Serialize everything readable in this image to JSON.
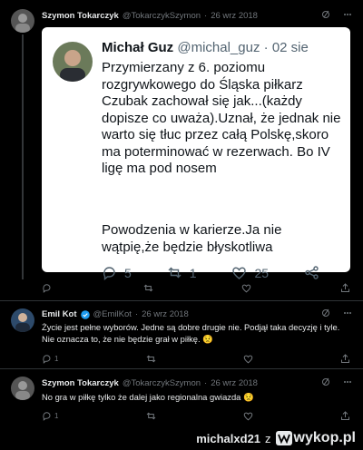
{
  "tweet1": {
    "name": "Szymon Tokarczyk",
    "handle": "@TokarczykSzymon",
    "dot": "·",
    "date": "26 wrz 2018"
  },
  "quoted": {
    "name": "Michał Guz",
    "handle": "@michal_guz",
    "dot": "·",
    "date": "02 sie",
    "text": "Przymierzany z 6. poziomu rozgrywkowego do Śląska piłkarz Czubak zachował się jak...(każdy dopisze co uważa).Uznał, że jednak nie warto się tłuc przez całą Polskę,skoro ma poterminować w rezerwach. Bo IV ligę ma pod nosem",
    "text2": "Powodzenia w karierze.Ja nie wątpię,że będzie błyskotliwa",
    "replies": "5",
    "retweets": "1",
    "likes": "25"
  },
  "tweet1_actions": {
    "replies": "",
    "retweets": "",
    "likes": ""
  },
  "tweet2": {
    "name": "Emil Kot",
    "handle": "@EmilKot",
    "dot": "·",
    "date": "26 wrz 2018",
    "text": "Życie jest pełne wyborów. Jedne są dobre drugie nie. Podjął taka decyzję i tyle. Nie oznacza to, że nie będzie grał w piłkę. 😟",
    "replies": "1",
    "retweets": "",
    "likes": ""
  },
  "tweet3": {
    "name": "Szymon Tokarczyk",
    "handle": "@TokarczykSzymon",
    "dot": "·",
    "date": "26 wrz 2018",
    "text": "No gra w piłkę tylko że dalej jako regionalna gwiazda 😟",
    "replies": "1",
    "retweets": "",
    "likes": ""
  },
  "footer": {
    "user": "michalxd21",
    "z": "z",
    "site": "wykop.pl"
  },
  "colors": {
    "background": "#000000",
    "text": "#e7e9ea",
    "muted": "#71767b",
    "verified": "#1d9bf0",
    "card": "#ffffff"
  }
}
